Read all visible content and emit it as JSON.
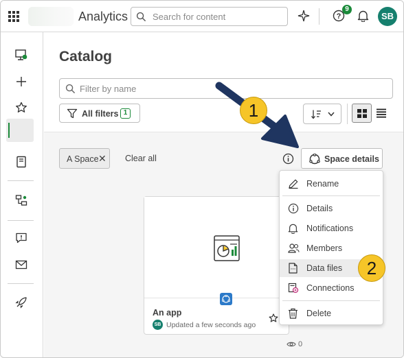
{
  "header": {
    "app_name": "Analytics",
    "search_placeholder": "Search for content",
    "notification_count": "9",
    "avatar_initials": "SB"
  },
  "sidebar": {
    "items": [
      {
        "icon": "hub-monitor-icon"
      },
      {
        "icon": "plus-icon"
      },
      {
        "icon": "star-icon"
      },
      {
        "icon": "bookmark-icon"
      },
      {
        "icon": "catalog-icon",
        "active": true
      },
      {
        "icon": "data-flow-icon"
      },
      {
        "icon": "alert-comment-icon"
      },
      {
        "icon": "mail-icon"
      },
      {
        "icon": "rocket-icon"
      }
    ]
  },
  "catalog": {
    "title": "Catalog",
    "filter_placeholder": "Filter by name",
    "all_filters_label": "All filters",
    "all_filters_count": "1",
    "chip_label": "A Space",
    "chip_remove": "✕",
    "clear_all": "Clear all",
    "space_details_label": "Space details"
  },
  "card": {
    "name": "An app",
    "avatar_initials": "SB",
    "updated": "Updated a few seconds ago",
    "views": "0"
  },
  "menu": {
    "items": [
      {
        "label": "Rename",
        "icon": "pencil-icon"
      },
      {
        "label": "Details",
        "icon": "info-icon"
      },
      {
        "label": "Notifications",
        "icon": "bell-icon"
      },
      {
        "label": "Members",
        "icon": "members-icon"
      },
      {
        "label": "Data files",
        "icon": "data-file-icon",
        "highlighted": true
      },
      {
        "label": "Connections",
        "icon": "connections-icon"
      },
      {
        "label": "Delete",
        "icon": "trash-icon"
      }
    ]
  },
  "callouts": [
    "1",
    "2"
  ],
  "colors": {
    "accent_green": "#1b8a3a",
    "avatar_teal": "#16806e",
    "callout_yellow": "#f6c528",
    "arrow_navy": "#1f3560",
    "space_blue": "#2c7ac9"
  }
}
